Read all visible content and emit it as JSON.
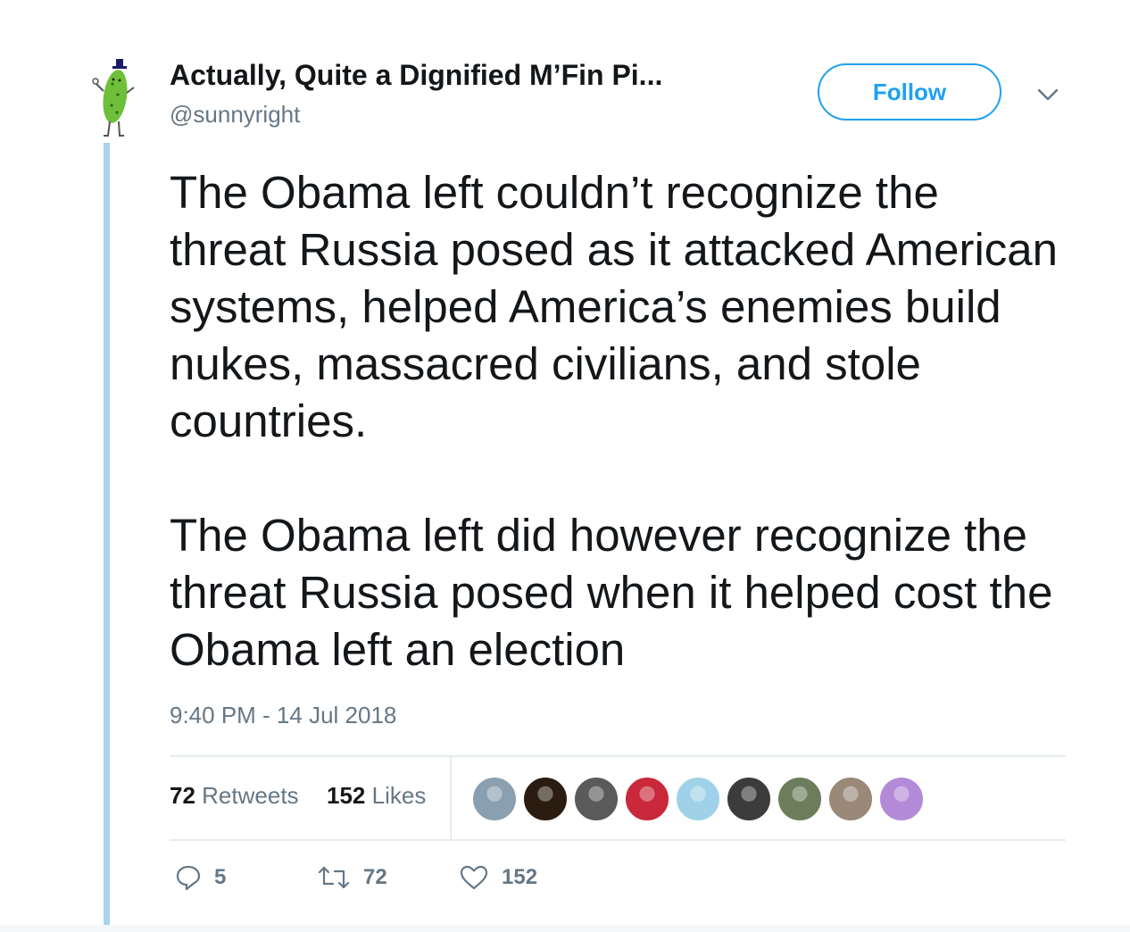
{
  "author": {
    "display_name": "Actually, Quite a Dignified M’Fin Pi...",
    "handle": "@sunnyright"
  },
  "follow_button_label": "Follow",
  "tweet": {
    "paragraphs": [
      "The Obama left couldn’t recognize the threat Russia posed as it attacked American systems, helped America’s enemies build nukes, massacred civilians, and stole countries.",
      "The Obama left did however recognize the threat Russia posed when it helped cost the Obama left an election"
    ],
    "timestamp": "9:40 PM - 14 Jul 2018"
  },
  "stats": {
    "retweets_count": "72",
    "retweets_label": "Retweets",
    "likes_count": "152",
    "likes_label": "Likes"
  },
  "liker_avatars": [
    {
      "name": "liker-avatar-1",
      "color": "#8aa0b0"
    },
    {
      "name": "liker-avatar-2",
      "color": "#2a1c10"
    },
    {
      "name": "liker-avatar-3",
      "color": "#5a5a5a"
    },
    {
      "name": "liker-avatar-4",
      "color": "#c8283a"
    },
    {
      "name": "liker-avatar-5",
      "color": "#9fd2e8"
    },
    {
      "name": "liker-avatar-6",
      "color": "#3c3c3c"
    },
    {
      "name": "liker-avatar-7",
      "color": "#6b7d5a"
    },
    {
      "name": "liker-avatar-8",
      "color": "#9a8878"
    },
    {
      "name": "liker-avatar-9",
      "color": "#b28ad8"
    }
  ],
  "actions": {
    "reply_count": "5",
    "retweet_count": "72",
    "like_count": "152"
  },
  "colors": {
    "accent": "#1da1f2",
    "thread_line": "#a9d3ee",
    "secondary_text": "#657786",
    "avatar_pickle": "#6fbf3a"
  },
  "icons": {
    "reply": "reply-icon",
    "retweet": "retweet-icon",
    "like": "heart-icon",
    "menu": "chevron-down-icon"
  }
}
